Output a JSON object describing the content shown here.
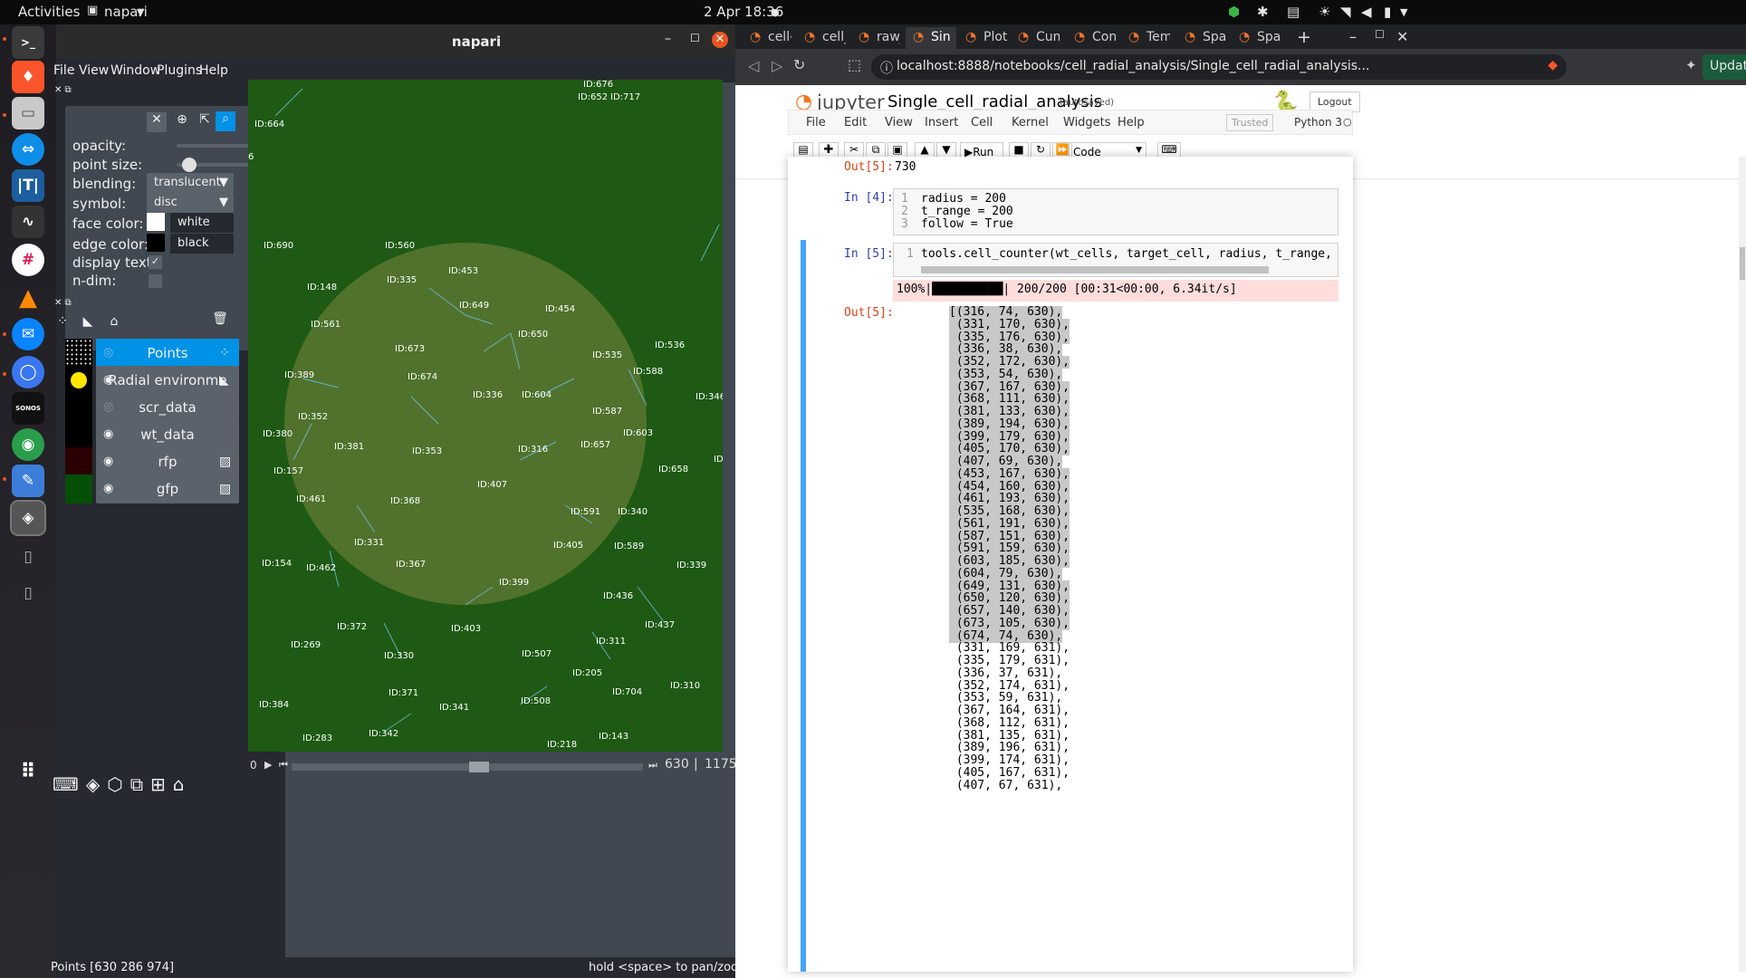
{
  "topbar": {
    "activities": "Activities",
    "app": "napari",
    "datetime": "2 Apr  18:36",
    "dot": "●"
  },
  "dock": {
    "icons": [
      "terminal-icon",
      "brave-icon",
      "files-icon",
      "teamviewer-icon",
      "jupyter-icon",
      "monitor-icon",
      "slack-icon",
      "vlc-icon",
      "thunderbird-icon",
      "signal-icon",
      "sonos-icon",
      "globe-icon",
      "text-editor-icon",
      "napari-icon",
      "usb-icon",
      "usb-icon",
      "apps-grid-icon"
    ],
    "sonos_label": "SONOS"
  },
  "napari": {
    "title": "napari",
    "menu": [
      "File",
      "View",
      "Window",
      "Plugins",
      "Help"
    ],
    "controls": {
      "opacity": "opacity:",
      "point_size": "point size:",
      "blending": "blending:",
      "blending_value": "translucent",
      "symbol": "symbol:",
      "symbol_value": "disc",
      "face_color": "face color:",
      "face_value": "white",
      "edge_color": "edge color:",
      "edge_value": "black",
      "display_text": "display text:",
      "ndim": "n-dim:",
      "opacity_level": 1.0,
      "point_size_level": 0.1
    },
    "layers": [
      {
        "name": "Points",
        "selected": true
      },
      {
        "name": "Radial environme",
        "selected": false
      },
      {
        "name": "scr_data",
        "selected": false
      },
      {
        "name": "wt_data",
        "selected": false
      },
      {
        "name": "rfp",
        "selected": false
      },
      {
        "name": "gfp",
        "selected": false
      }
    ],
    "cell_ids": [
      "ID:676",
      "ID:652",
      "ID:717",
      "ID:664",
      "ID:690",
      "ID:560",
      "ID:453",
      "ID:335",
      "ID:148",
      "ID:649",
      "ID:454",
      "ID:561",
      "ID:650",
      "ID:536",
      "ID:673",
      "ID:535",
      "ID:389",
      "ID:674",
      "ID:588",
      "ID:336",
      "ID:604",
      "ID:346",
      "ID:352",
      "ID:587",
      "ID:380",
      "ID:381",
      "ID:353",
      "ID:316",
      "ID:657",
      "ID:603",
      "ID:157",
      "ID:658",
      "ID:407",
      "ID:461",
      "ID:368",
      "ID:591",
      "ID:340",
      "ID:331",
      "ID:405",
      "ID:589",
      "ID:154",
      "ID:462",
      "ID:367",
      "ID:339",
      "ID:399",
      "ID:436",
      "ID:372",
      "ID:403",
      "ID:437",
      "ID:269",
      "ID:311",
      "ID:330",
      "ID:507",
      "ID:205",
      "ID:310",
      "ID:371",
      "ID:704",
      "ID:384",
      "ID:341",
      "ID:508",
      "ID:283",
      "ID:342",
      "ID:143",
      "ID:218",
      "6",
      "ID"
    ],
    "frame": {
      "start": "0",
      "current": "630",
      "max": "1175"
    },
    "status_left": "Points [630 286 974]",
    "status_right": "hold <space> to pan/zoom"
  },
  "browser": {
    "tabs": [
      "cell-c",
      "cell_r",
      "raw_c",
      "Sin",
      "Plotti",
      "Cumu",
      "Contr",
      "Temp",
      "Spatia",
      "Spatia"
    ],
    "url": "localhost:8888/notebooks/cell_radial_analysis/Single_cell_radial_analysis...",
    "update": "Update"
  },
  "jupyter": {
    "logo": "jupyter",
    "notebook": "Single_cell_radial_analysis",
    "autosaved": "(autosaved)",
    "logout": "Logout",
    "menu": [
      "File",
      "Edit",
      "View",
      "Insert",
      "Cell",
      "Kernel",
      "Widgets",
      "Help"
    ],
    "trusted": "Trusted",
    "kernel": "Python 3",
    "run": "Run",
    "celltype": "Code",
    "out_prev_prompt": "Out[5]:",
    "out_prev_value": "730",
    "in4_prompt": "In [4]:",
    "in4_lines": [
      {
        "n": "1",
        "code": "radius = 200"
      },
      {
        "n": "2",
        "code": "t_range = 200"
      },
      {
        "n": "3",
        "code": "follow = True"
      }
    ],
    "in5_prompt": "In [5]:",
    "in5_line": {
      "n": "1",
      "code": "tools.cell_counter(wt_cells, target_cell, radius, t_range, focal_ti"
    },
    "progress": "100%|██████████| 200/200 [00:31<00:00,  6.34it/s]",
    "out5_prompt": "Out[5]:",
    "output": [
      "[(316, 74, 630),",
      " (331, 170, 630),",
      " (335, 176, 630),",
      " (336, 38, 630),",
      " (352, 172, 630),",
      " (353, 54, 630),",
      " (367, 167, 630),",
      " (368, 111, 630),",
      " (381, 133, 630),",
      " (389, 194, 630),",
      " (399, 179, 630),",
      " (405, 170, 630),",
      " (407, 69, 630),",
      " (453, 167, 630),",
      " (454, 160, 630),",
      " (461, 193, 630),",
      " (535, 168, 630),",
      " (561, 191, 630),",
      " (587, 151, 630),",
      " (591, 159, 630),",
      " (603, 185, 630),",
      " (604, 79, 630),",
      " (649, 131, 630),",
      " (650, 120, 630),",
      " (657, 140, 630),",
      " (673, 105, 630),",
      " (674, 74, 630),",
      " (331, 169, 631),",
      " (335, 179, 631),",
      " (336, 37, 631),",
      " (352, 174, 631),",
      " (353, 59, 631),",
      " (367, 164, 631),",
      " (368, 112, 631),",
      " (381, 135, 631),",
      " (389, 196, 631),",
      " (399, 174, 631),",
      " (405, 167, 631),",
      " (407, 67, 631),"
    ]
  }
}
